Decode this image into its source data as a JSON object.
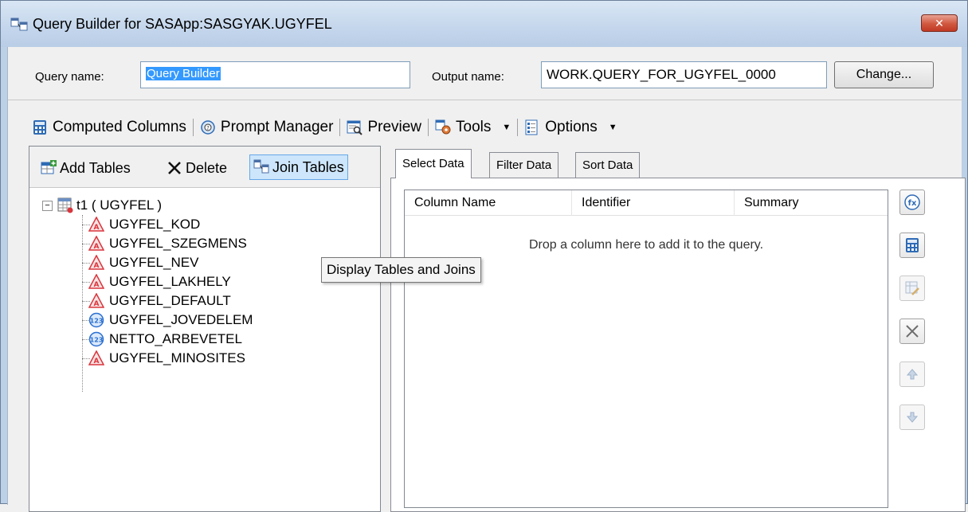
{
  "window": {
    "title": "Query Builder for SASApp:SASGYAK.UGYFEL",
    "close_label": "✕"
  },
  "form": {
    "query_name_label": "Query name:",
    "query_name_value": "Query Builder",
    "output_name_label": "Output name:",
    "output_name_value": "WORK.QUERY_FOR_UGYFEL_0000",
    "change_button": "Change..."
  },
  "toolbar": {
    "computed_columns": "Computed Columns",
    "prompt_manager": "Prompt Manager",
    "preview": "Preview",
    "tools": "Tools",
    "options": "Options",
    "caret": "▼"
  },
  "left_toolbar": {
    "add_tables": "Add Tables",
    "delete": "Delete",
    "join_tables": "Join Tables"
  },
  "tree": {
    "root_label": "t1 ( UGYFEL )",
    "expander": "−",
    "columns": [
      {
        "name": "UGYFEL_KOD",
        "type": "character",
        "icon": "character-column-icon"
      },
      {
        "name": "UGYFEL_SZEGMENS",
        "type": "character",
        "icon": "character-column-icon"
      },
      {
        "name": "UGYFEL_NEV",
        "type": "character",
        "icon": "character-column-icon"
      },
      {
        "name": "UGYFEL_LAKHELY",
        "type": "character",
        "icon": "character-column-icon"
      },
      {
        "name": "UGYFEL_DEFAULT",
        "type": "character",
        "icon": "character-column-icon"
      },
      {
        "name": "UGYFEL_JOVEDELEM",
        "type": "numeric",
        "icon": "numeric-column-icon"
      },
      {
        "name": "NETTO_ARBEVETEL",
        "type": "numeric",
        "icon": "numeric-column-icon"
      },
      {
        "name": "UGYFEL_MINOSITES",
        "type": "character",
        "icon": "character-column-icon"
      }
    ]
  },
  "tooltip": "Display Tables and Joins",
  "tabs": [
    {
      "label": "Select Data",
      "active": true
    },
    {
      "label": "Filter Data",
      "active": false
    },
    {
      "label": "Sort Data",
      "active": false
    }
  ],
  "select_data": {
    "columns": [
      "Column Name",
      "Identifier",
      "Summary"
    ],
    "empty_message": "Drop a column here to add it to the query."
  },
  "side_buttons": [
    {
      "name": "properties-button",
      "icon": "properties-icon",
      "enabled": true
    },
    {
      "name": "computed-column-button",
      "icon": "calculator-icon",
      "enabled": true
    },
    {
      "name": "edit-column-button",
      "icon": "edit-column-icon",
      "enabled": false
    },
    {
      "name": "remove-column-button",
      "icon": "close-icon",
      "enabled": true
    },
    {
      "name": "move-up-button",
      "icon": "arrow-up-icon",
      "enabled": false
    },
    {
      "name": "move-down-button",
      "icon": "arrow-down-icon",
      "enabled": false
    }
  ],
  "colors": {
    "titlebar": "#c4d6ec",
    "selection": "#3399ff",
    "active_button": "#cde6fb",
    "character_icon": "#d9363e",
    "numeric_icon": "#2a6fd1"
  }
}
